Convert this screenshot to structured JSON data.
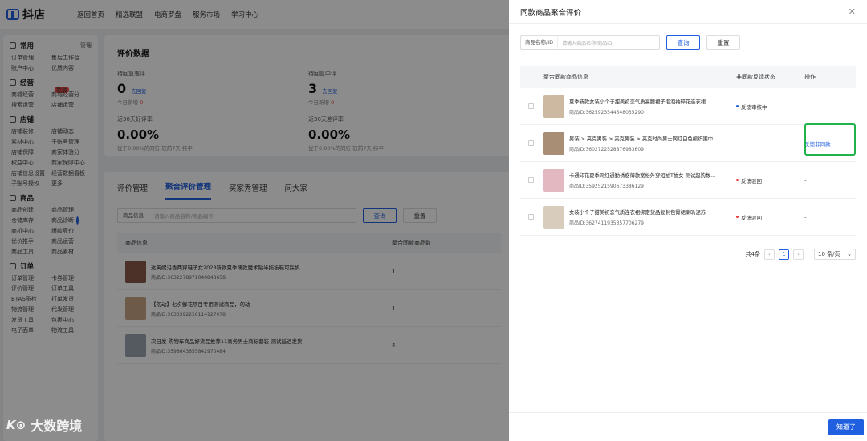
{
  "app": {
    "logo_text": "抖店"
  },
  "topnav": [
    "返回首页",
    "精选联盟",
    "电商罗盘",
    "服务市场",
    "学习中心"
  ],
  "sidebar": {
    "manage_label": "管理",
    "groups": [
      {
        "title": "常用",
        "items": [
          "订单管理",
          "售后工作台",
          "账户中心",
          "优质内容"
        ]
      },
      {
        "title": "经营",
        "items": [
          "商城经营",
          "商城经营分",
          "搜索运营",
          "店铺运营"
        ]
      },
      {
        "title": "店铺",
        "items": [
          "店铺装修",
          "店铺动态",
          "素材中心",
          "子账号管理",
          "店铺保障",
          "商家体验分",
          "权益中心",
          "商家保障中心",
          "店铺信息设置",
          "经营数据看板",
          "子账号授权",
          "更多"
        ]
      },
      {
        "title": "商品",
        "items": [
          "商品创建",
          "商品管理",
          "仓储库存",
          "商品诊断",
          "商机中心",
          "爆款竞价",
          "优价推手",
          "商品运营",
          "商品工具",
          "商品素材"
        ]
      },
      {
        "title": "订单",
        "items": [
          "订单管理",
          "卡券管理",
          "评价管理",
          "订单工具",
          "BTAS质检",
          "打单发货",
          "物流管理",
          "代发管理",
          "发货工具",
          "包裹中心",
          "电子面单",
          "物流工具"
        ]
      }
    ],
    "new_badge": "新版"
  },
  "main": {
    "title": "评价数据",
    "stats": [
      {
        "label": "待回复差评",
        "value": "0",
        "link": "去回复",
        "sub_label": "今日新增",
        "sub_value": "0"
      },
      {
        "label": "待回复中评",
        "value": "3",
        "link": "去回复",
        "sub_label": "今日新增",
        "sub_value": "0"
      }
    ],
    "rates": [
      {
        "label": "近30天好评率",
        "value": "0.00%",
        "sub": "优于0.00%的同行  较前7天 持平"
      },
      {
        "label": "近30天差评率",
        "value": "0.00%",
        "sub": "优于0.00%的同行  较前7天 持平"
      }
    ],
    "tabs": [
      "评价管理",
      "聚合评价管理",
      "买家秀管理",
      "问大家"
    ],
    "search": {
      "label": "商品信息",
      "placeholder": "请输入商品名称/商品编号",
      "query": "查询",
      "reset": "重置"
    },
    "table": {
      "headers": [
        "商品信息",
        "聚合同款商品数"
      ],
      "rows": [
        {
          "title": "达芙妮沿香两穿鞋子女2023新款夏季薄款魔术贴半拖板鞋可踩帆",
          "id": "商品ID:3632278971040848658",
          "count": "1"
        },
        {
          "title": "【勿动】七夕鲜花项目专用测试商品，勿动",
          "id": "商品ID:3630392256114127978",
          "count": "1"
        },
        {
          "title": "次日发-购物车商品好货品推荐11商务男士商标套装-测试延迟发货",
          "id": "商品ID:3598643655842970484",
          "count": "4"
        }
      ]
    }
  },
  "watermark": {
    "text": "大数跨境"
  },
  "drawer": {
    "title": "同款商品聚合评价",
    "search": {
      "label": "商品名称/ID",
      "placeholder": "请输入商品名称/商品ID",
      "query": "查询",
      "reset": "重置"
    },
    "headers": [
      "聚合同款商品信息",
      "非同款反馈状态",
      "操作"
    ],
    "rows": [
      {
        "title": "夏季新款女装小个子甜美初恋气质高腰裙子泡泡袖碎花连衣裙",
        "id": "商品ID:3625923544548035290",
        "status": "反馈审核中",
        "status_color": "#1f5fe0",
        "op": "-",
        "highlight": false
      },
      {
        "title": "男装 > 夹克男装 > 夹克男装 > 夹克时尚男士网红白色编织围巾",
        "id": "商品ID:3602722528876983609",
        "status": "-",
        "status_color": "",
        "op": "反馈非同款",
        "highlight": true
      },
      {
        "title": "卡通印花夏季网红通勤诱惑薄款宽松外穿短袖T恤女-测试起购数...",
        "id": "商品ID:3592521590673386129",
        "status": "反馈驳回",
        "status_color": "#e53935",
        "op": "-",
        "highlight": false
      },
      {
        "title": "女装小个子甜美初恋气质连衣裙绑定货品复制包臀裙喇叭泥苏",
        "id": "商品ID:3627411935357706279",
        "status": "反馈驳回",
        "status_color": "#e53935",
        "op": "-",
        "highlight": false
      }
    ],
    "pager": {
      "total": "共4条",
      "page": "1",
      "size": "10 条/页"
    },
    "ok_button": "知道了"
  }
}
